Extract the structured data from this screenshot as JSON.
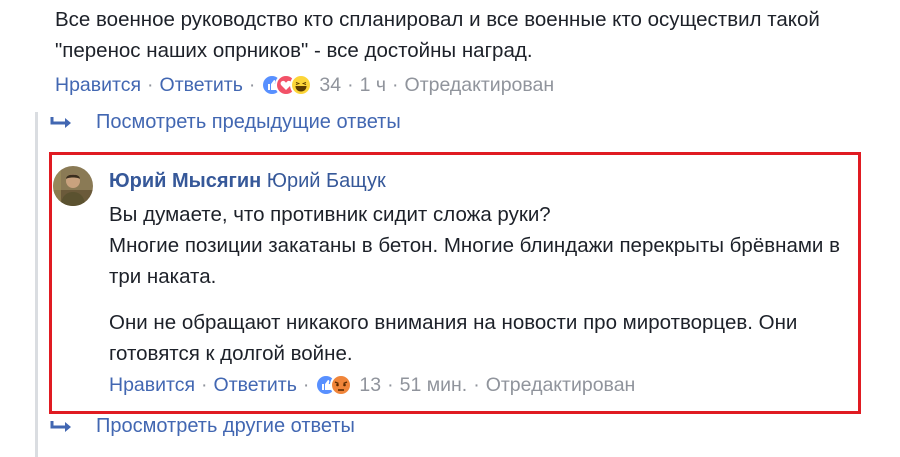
{
  "top_comment": {
    "text": "Все военное руководство кто спланировал и все военные кто осуществил такой \"перенос наших опрников\" - все достойны наград.",
    "like_label": "Нравится",
    "reply_label": "Ответить",
    "reactions": [
      "like-icon",
      "love-icon",
      "haha-icon"
    ],
    "reaction_count": "34",
    "time": "1 ч",
    "edited_label": "Отредактирован"
  },
  "view_previous": {
    "label": "Посмотреть предыдущие ответы"
  },
  "reply": {
    "author": "Юрий Мысягин",
    "mention": "Юрий Бащук",
    "paragraphs": [
      "Вы думаете, что противник сидит сложа руки?\nМногие позиции закатаны в бетон. Многие блиндажи перекрыты брёвнами в три наката.",
      "Они не обращают никакого внимания на новости про миротворцев. Они готовятся к долгой войне."
    ],
    "like_label": "Нравится",
    "reply_label": "Ответить",
    "reactions": [
      "like-icon",
      "angry-icon"
    ],
    "reaction_count": "13",
    "time": "51 мин.",
    "edited_label": "Отредактирован"
  },
  "view_other": {
    "label": "Просмотреть другие ответы"
  },
  "separator": "·",
  "colors": {
    "link": "#4267b2",
    "author": "#365899",
    "meta": "#90949c",
    "highlight": "#e01b22",
    "thread_line": "#dadde1"
  }
}
